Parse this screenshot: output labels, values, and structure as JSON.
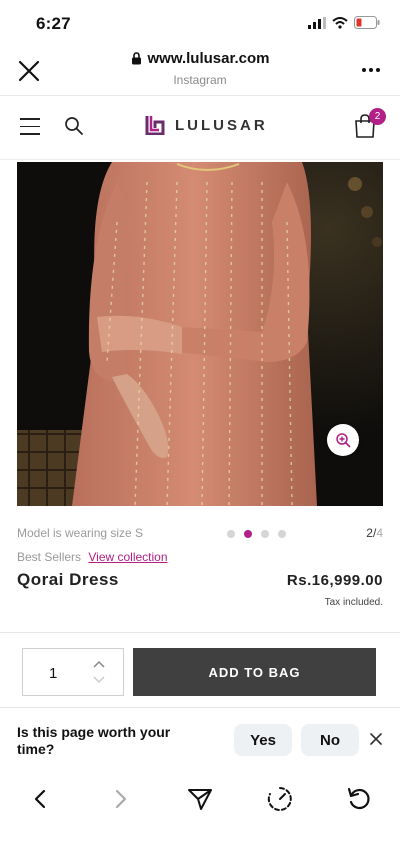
{
  "status_bar": {
    "time": "6:27"
  },
  "browser": {
    "url": "www.lulusar.com",
    "source": "Instagram"
  },
  "site": {
    "brand": "LULUSAR",
    "cart_count": "2",
    "brand_color": "#b21f86"
  },
  "product": {
    "model_note": "Model is wearing size S",
    "pager_current": "2/",
    "pager_total": "4",
    "active_image_index": 2,
    "image_count": 4,
    "collection_label": "Best Sellers",
    "collection_link": "View collection",
    "name": "Qorai Dress",
    "price": "Rs.16,999.00",
    "tax_note": "Tax included."
  },
  "purchase": {
    "quantity": "1",
    "add_button": "ADD TO BAG"
  },
  "feedback": {
    "question": "Is this page worth your time?",
    "yes": "Yes",
    "no": "No"
  },
  "toolbar": {
    "items": [
      "back-icon",
      "forward-icon",
      "share-icon",
      "speed-icon",
      "refresh-icon"
    ]
  }
}
